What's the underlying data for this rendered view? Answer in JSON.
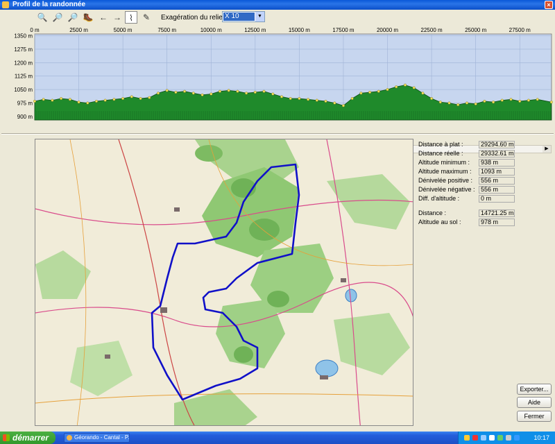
{
  "window": {
    "title": "Profil de la randonnée",
    "close_label": "×"
  },
  "toolbar": {
    "buttons": [
      {
        "name": "zoom-in-icon",
        "glyph": "🔍"
      },
      {
        "name": "zoom-plus-icon",
        "glyph": "🔎"
      },
      {
        "name": "zoom-minus-icon",
        "glyph": "🔎"
      },
      {
        "name": "hiker-icon",
        "glyph": "🥾"
      },
      {
        "name": "arrow-left-icon",
        "glyph": "←"
      },
      {
        "name": "arrow-right-icon",
        "glyph": "→"
      },
      {
        "name": "profile-mode-icon",
        "glyph": "⌇"
      },
      {
        "name": "pen-icon",
        "glyph": "✎"
      }
    ],
    "exaggeration_label": "Exagération du relief :",
    "exaggeration_value": "X 10"
  },
  "profile": {
    "x_ticks": [
      "0 m",
      "2500 m",
      "5000 m",
      "7500 m",
      "10000 m",
      "12500 m",
      "15000 m",
      "17500 m",
      "20000 m",
      "22500 m",
      "25000 m",
      "27500 m"
    ],
    "y_ticks": [
      "1350 m",
      "1275 m",
      "1200 m",
      "1125 m",
      "1050 m",
      "975 m",
      "900 m"
    ],
    "x_max": 29300,
    "y_range": [
      880,
      1360
    ],
    "elevation": [
      [
        0,
        985
      ],
      [
        500,
        995
      ],
      [
        1000,
        990
      ],
      [
        1500,
        1000
      ],
      [
        2000,
        995
      ],
      [
        2500,
        980
      ],
      [
        3000,
        975
      ],
      [
        3500,
        985
      ],
      [
        4000,
        990
      ],
      [
        4500,
        995
      ],
      [
        5000,
        1000
      ],
      [
        5500,
        1010
      ],
      [
        6000,
        1000
      ],
      [
        6500,
        1005
      ],
      [
        7000,
        1030
      ],
      [
        7500,
        1045
      ],
      [
        8000,
        1035
      ],
      [
        8500,
        1040
      ],
      [
        9000,
        1030
      ],
      [
        9500,
        1020
      ],
      [
        10000,
        1025
      ],
      [
        10500,
        1040
      ],
      [
        11000,
        1045
      ],
      [
        11500,
        1040
      ],
      [
        12000,
        1030
      ],
      [
        12500,
        1035
      ],
      [
        13000,
        1040
      ],
      [
        13500,
        1025
      ],
      [
        14000,
        1010
      ],
      [
        14500,
        1000
      ],
      [
        15000,
        1000
      ],
      [
        15500,
        995
      ],
      [
        16000,
        990
      ],
      [
        16500,
        985
      ],
      [
        17000,
        975
      ],
      [
        17500,
        960
      ],
      [
        18000,
        1000
      ],
      [
        18500,
        1030
      ],
      [
        19000,
        1035
      ],
      [
        19500,
        1040
      ],
      [
        20000,
        1050
      ],
      [
        20500,
        1065
      ],
      [
        21000,
        1075
      ],
      [
        21500,
        1060
      ],
      [
        22000,
        1030
      ],
      [
        22500,
        1000
      ],
      [
        23000,
        980
      ],
      [
        23500,
        975
      ],
      [
        24000,
        965
      ],
      [
        24500,
        975
      ],
      [
        25000,
        970
      ],
      [
        25500,
        985
      ],
      [
        26000,
        980
      ],
      [
        26500,
        990
      ],
      [
        27000,
        995
      ],
      [
        27500,
        985
      ],
      [
        28000,
        990
      ],
      [
        28500,
        995
      ],
      [
        29294,
        980
      ]
    ]
  },
  "stats": [
    {
      "label": "Distance à plat :",
      "value": "29294.60 m"
    },
    {
      "label": "Distance réelle :",
      "value": "29332.61 m"
    },
    {
      "label": "Altitude minimum :",
      "value": "938 m"
    },
    {
      "label": "Altitude maximum :",
      "value": "1093 m"
    },
    {
      "label": "Dénivelée positive :",
      "value": "556 m"
    },
    {
      "label": "Dénivelée négative :",
      "value": "556 m"
    },
    {
      "label": "Diff. d'altitude :",
      "value": "0 m"
    },
    {
      "label": "Distance :",
      "value": "14721.25 m"
    },
    {
      "label": "Altitude au sol :",
      "value": "978 m"
    }
  ],
  "buttons": {
    "export": "Exporter...",
    "help": "Aide",
    "close": "Fermer"
  },
  "taskbar": {
    "start_label": "démarrer",
    "task_label": "Géorando - Cantal - P...",
    "clock": "10:17"
  },
  "colors": {
    "terrain_fill": "#1f8a2b",
    "sky": "#c7d6ef",
    "route": "#1010c8",
    "title_bar": "#0a58d8"
  }
}
